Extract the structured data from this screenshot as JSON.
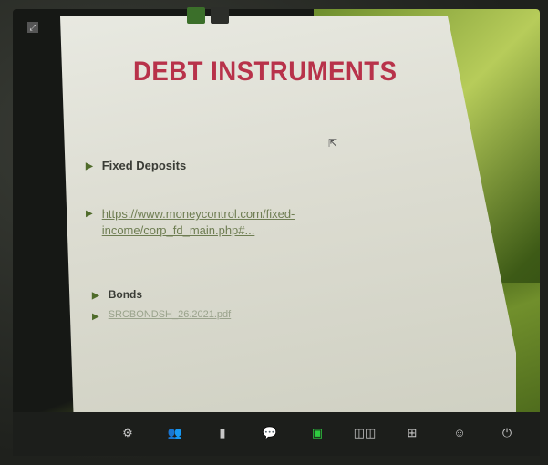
{
  "meeting": {
    "top_pills": [
      "",
      ""
    ]
  },
  "slide": {
    "title": "DEBT INSTRUMENTS",
    "bullets": [
      {
        "text": "Fixed Deposits"
      },
      {
        "text": "https://www.moneycontrol.com/fixed-income/corp_fd_main.php#..."
      },
      {
        "text": "Bonds"
      },
      {
        "text": "SRCBONDSH_26.2021.pdf"
      }
    ]
  },
  "toolbar": {
    "items": [
      {
        "icon": "gear-icon",
        "label": ""
      },
      {
        "icon": "participants-icon",
        "label": ""
      },
      {
        "icon": "polls-icon",
        "label": ""
      },
      {
        "icon": "chat-icon",
        "label": ""
      },
      {
        "icon": "share-screen-icon",
        "label": ""
      },
      {
        "icon": "record-icon",
        "label": ""
      },
      {
        "icon": "breakout-rooms-icon",
        "label": ""
      },
      {
        "icon": "reactions-icon",
        "label": ""
      },
      {
        "icon": "leave-icon",
        "label": ""
      }
    ]
  }
}
